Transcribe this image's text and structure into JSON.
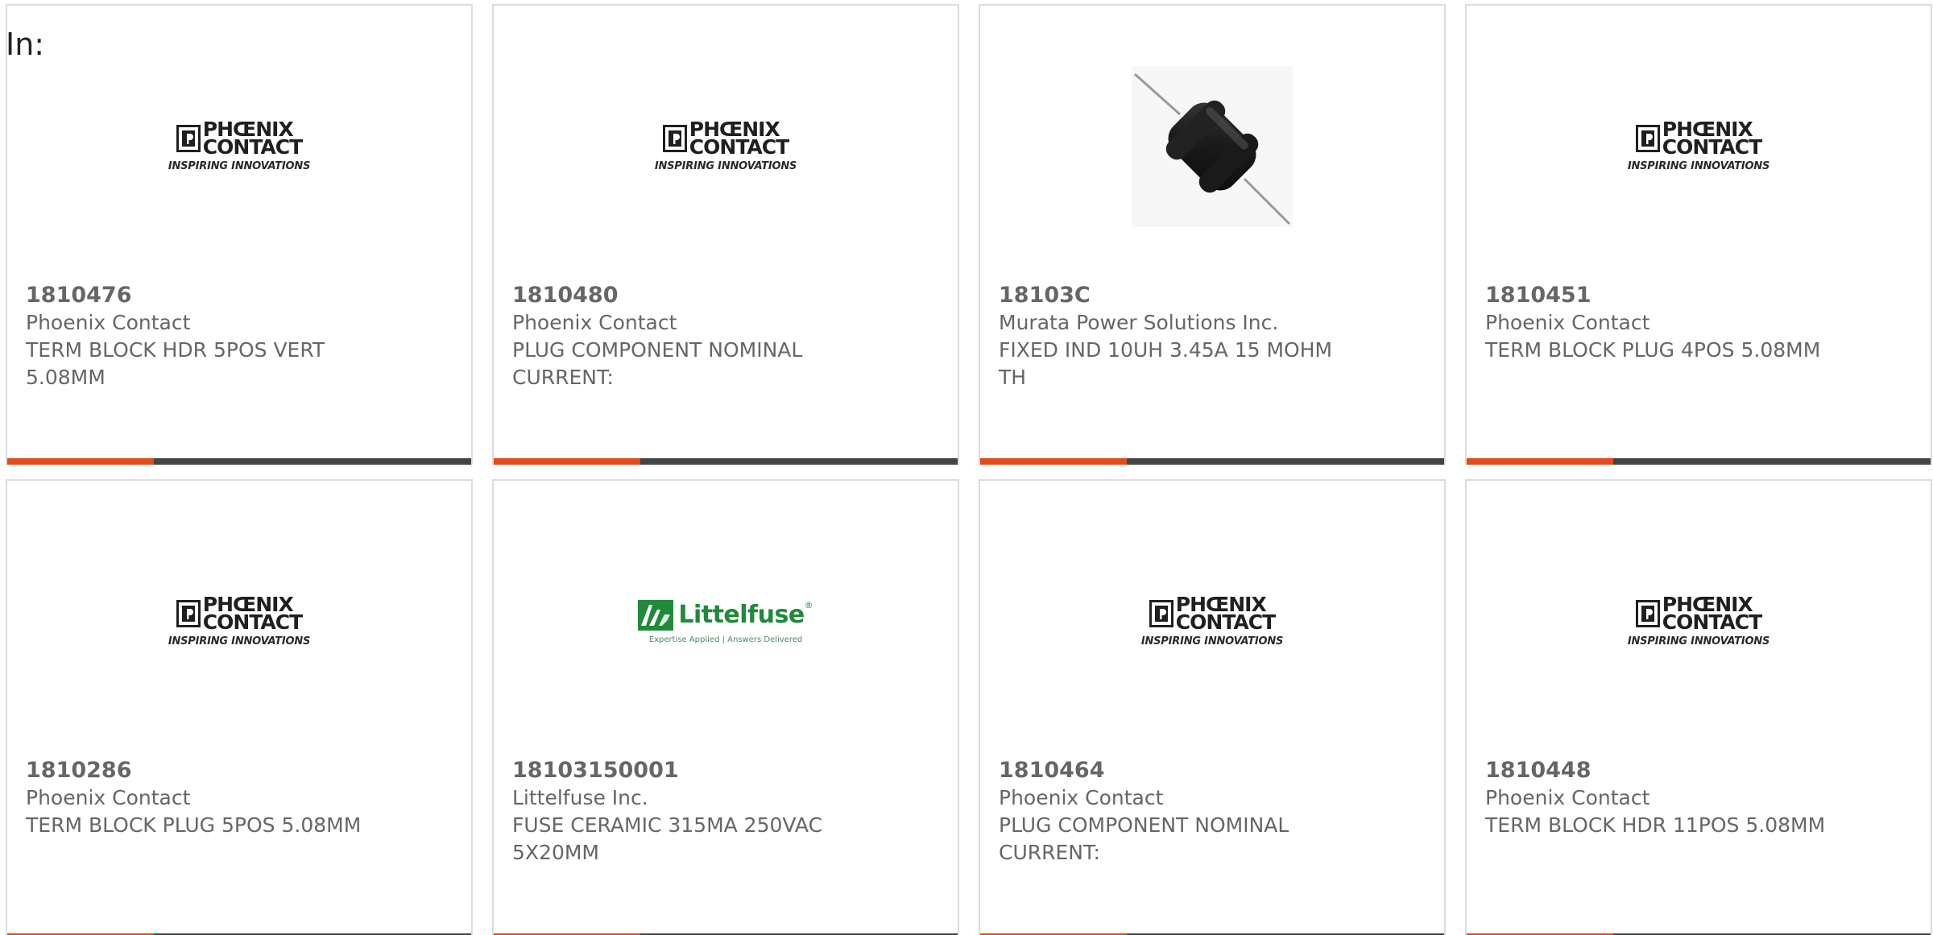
{
  "header": {
    "label": "In:"
  },
  "logos": {
    "phoenix": {
      "line1": "PHŒNIX",
      "line2": "CONTACT",
      "tagline": "INSPIRING INNOVATIONS"
    },
    "littelfuse": {
      "name": "Littelfuse",
      "registered": "®",
      "tagline": "Expertise Applied | Answers Delivered"
    }
  },
  "colors": {
    "accent_bar": "#e24a1a",
    "bar": "#444444",
    "text": "#666666",
    "littelfuse_green": "#1f8a3a"
  },
  "products": [
    {
      "part_number": "1810476",
      "manufacturer": "Phoenix Contact",
      "description": "TERM BLOCK HDR 5POS VERT 5.08MM",
      "image": "phoenix-contact-logo"
    },
    {
      "part_number": "1810480",
      "manufacturer": "Phoenix Contact",
      "description": "PLUG COMPONENT NOMINAL CURRENT:",
      "image": "phoenix-contact-logo"
    },
    {
      "part_number": "18103C",
      "manufacturer": "Murata Power Solutions Inc.",
      "description": "FIXED IND 10UH 3.45A 15 MOHM TH",
      "image": "inductor-photo"
    },
    {
      "part_number": "1810451",
      "manufacturer": "Phoenix Contact",
      "description": "TERM BLOCK PLUG 4POS 5.08MM",
      "image": "phoenix-contact-logo"
    },
    {
      "part_number": "1810286",
      "manufacturer": "Phoenix Contact",
      "description": "TERM BLOCK PLUG 5POS 5.08MM",
      "image": "phoenix-contact-logo"
    },
    {
      "part_number": "18103150001",
      "manufacturer": "Littelfuse Inc.",
      "description": "FUSE CERAMIC 315MA 250VAC 5X20MM",
      "image": "littelfuse-logo"
    },
    {
      "part_number": "1810464",
      "manufacturer": "Phoenix Contact",
      "description": "PLUG COMPONENT NOMINAL CURRENT:",
      "image": "phoenix-contact-logo"
    },
    {
      "part_number": "1810448",
      "manufacturer": "Phoenix Contact",
      "description": "TERM BLOCK HDR 11POS 5.08MM",
      "image": "phoenix-contact-logo"
    }
  ]
}
